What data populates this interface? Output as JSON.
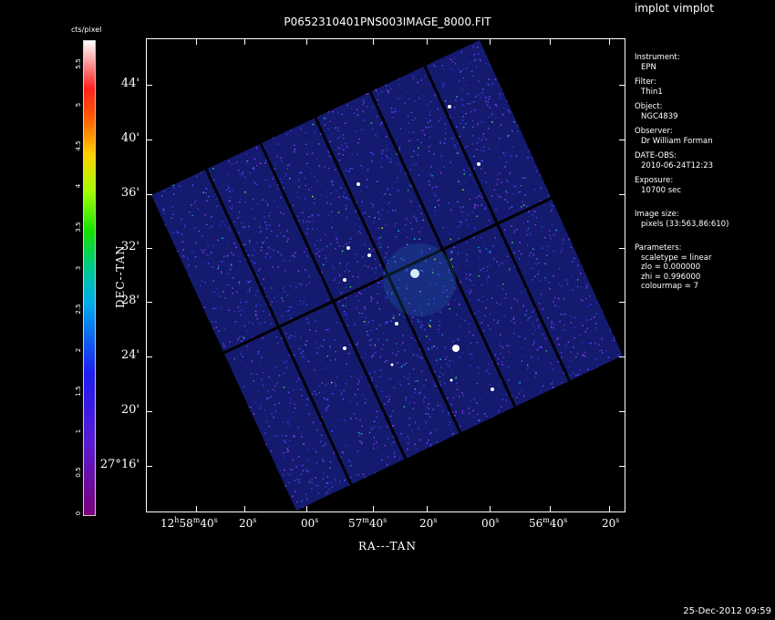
{
  "app_title": "implot vimplot",
  "plot_title": "P0652310401PNS003IMAGE_8000.FIT",
  "colorbar": {
    "title": "cts/pixel",
    "tick_labels": [
      "0",
      "0.5",
      "1",
      "1.5",
      "2",
      "2.5",
      "3",
      "3.5",
      "4",
      "4.5",
      "5",
      "5.5"
    ]
  },
  "axes": {
    "xlabel": "RA---TAN",
    "ylabel": "DEC--TAN",
    "y_ticks": [
      "44'",
      "40'",
      "36'",
      "32'",
      "28'",
      "24'",
      "20'",
      "27°16'"
    ],
    "x_ticks": [
      {
        "main": "12",
        "sup1": "h",
        "mid": "58",
        "sup2": "m",
        "tail": "40",
        "sup3": "s"
      },
      {
        "main": "20",
        "sup3": "s"
      },
      {
        "main": "00",
        "sup3": "s"
      },
      {
        "main": "57",
        "sup2": "m",
        "tail": "40",
        "sup3": "s"
      },
      {
        "main": "20",
        "sup3": "s"
      },
      {
        "main": "00",
        "sup3": "s"
      },
      {
        "main": "56",
        "sup2": "m",
        "tail": "40",
        "sup3": "s"
      },
      {
        "main": "20",
        "sup3": "s"
      }
    ]
  },
  "info": {
    "instrument_label": "Instrument:",
    "instrument": "EPN",
    "filter_label": "Filter:",
    "filter": "Thin1",
    "object_label": "Object:",
    "object": "NGC4839",
    "observer_label": "Observer:",
    "observer": "Dr William Forman",
    "date_label": "DATE-OBS:",
    "date": "2010-06-24T12:23",
    "exposure_label": "Exposure:",
    "exposure": "10700 sec",
    "imagesize_label": "Image size:",
    "imagesize": "pixels (33:563,86:610)",
    "parameters_label": "Parameters:",
    "scaletype": "scaletype = linear",
    "zlo": "zlo = 0.000000",
    "zhi": "zhi = 0.996000",
    "colourmap": "colourmap =   7"
  },
  "timestamp": "25-Dec-2012 09:59",
  "colors": {
    "background": "#000000",
    "foreground": "#ffffff",
    "sky_base": "#141a6e"
  }
}
